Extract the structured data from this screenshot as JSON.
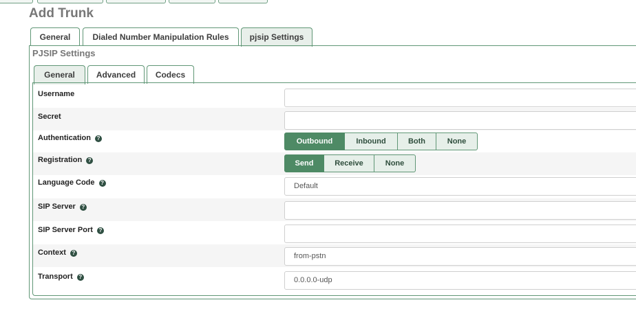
{
  "page": {
    "title": "Add Trunk"
  },
  "main_tabs": [
    {
      "label": "General"
    },
    {
      "label": "Dialed Number Manipulation Rules"
    },
    {
      "label": "pjsip Settings"
    }
  ],
  "section": {
    "title": "PJSIP Settings"
  },
  "sub_tabs": [
    {
      "label": "General"
    },
    {
      "label": "Advanced"
    },
    {
      "label": "Codecs"
    }
  ],
  "fields": {
    "username": {
      "label": "Username",
      "value": ""
    },
    "secret": {
      "label": "Secret",
      "value": ""
    },
    "authentication": {
      "label": "Authentication",
      "options": [
        "Outbound",
        "Inbound",
        "Both",
        "None"
      ],
      "selected": "Outbound"
    },
    "registration": {
      "label": "Registration",
      "options": [
        "Send",
        "Receive",
        "None"
      ],
      "selected": "Send"
    },
    "language_code": {
      "label": "Language Code",
      "value": "Default"
    },
    "sip_server": {
      "label": "SIP Server",
      "value": ""
    },
    "sip_server_port": {
      "label": "SIP Server Port",
      "value": ""
    },
    "context": {
      "label": "Context",
      "value": "from-pstn"
    },
    "transport": {
      "label": "Transport",
      "value": "0.0.0.0-udp"
    }
  },
  "help_glyph": "?",
  "colors": {
    "accent": "#4e8a65",
    "tab_border": "#5f9675",
    "active_tab_bg": "#e8efea"
  }
}
